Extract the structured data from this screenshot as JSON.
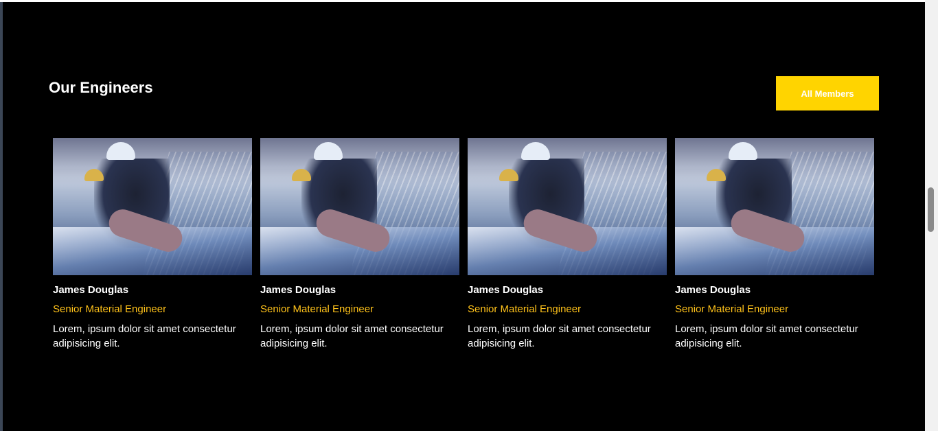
{
  "section": {
    "title": "Our Engineers",
    "button_label": "All Members"
  },
  "colors": {
    "background": "#000000",
    "button_bg": "#ffd400",
    "role_text": "#ffc21a"
  },
  "engineers": [
    {
      "name": "James Douglas",
      "role": "Senior Material Engineer",
      "description": "Lorem, ipsum dolor sit amet consectetur adipisicing elit."
    },
    {
      "name": "James Douglas",
      "role": "Senior Material Engineer",
      "description": "Lorem, ipsum dolor sit amet consectetur adipisicing elit."
    },
    {
      "name": "James Douglas",
      "role": "Senior Material Engineer",
      "description": "Lorem, ipsum dolor sit amet consectetur adipisicing elit."
    },
    {
      "name": "James Douglas",
      "role": "Senior Material Engineer",
      "description": "Lorem, ipsum dolor sit amet consectetur adipisicing elit."
    }
  ]
}
